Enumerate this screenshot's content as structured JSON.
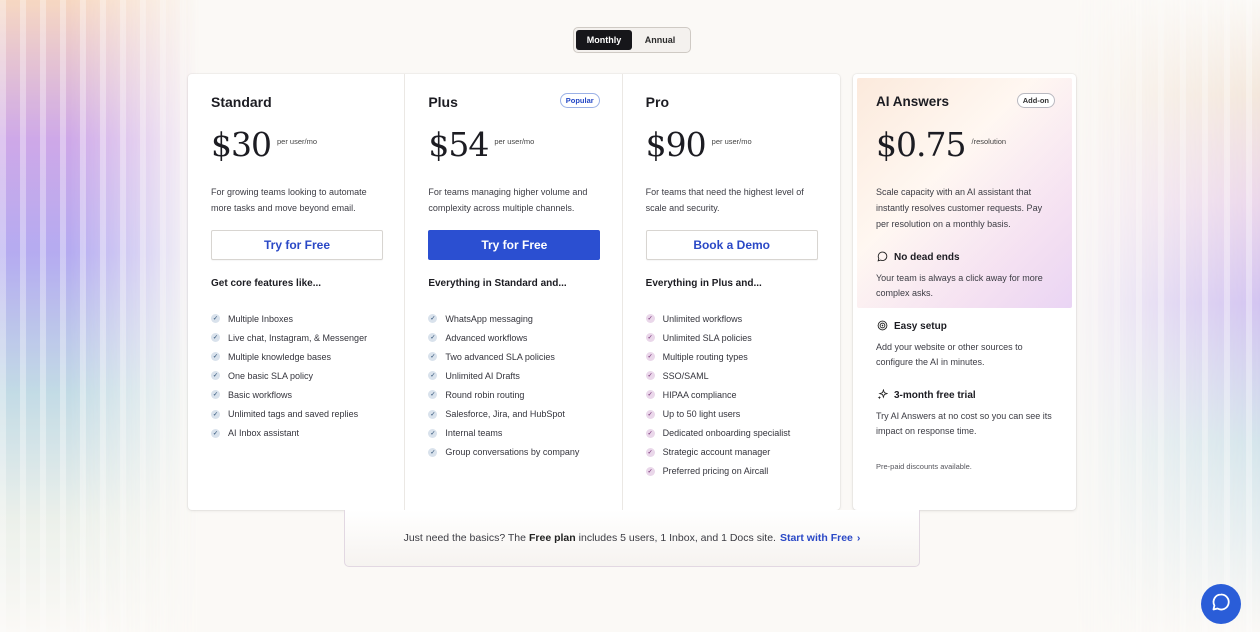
{
  "billing_toggle": {
    "monthly": "Monthly",
    "annual": "Annual",
    "selected": "Monthly"
  },
  "plans": [
    {
      "name": "Standard",
      "badge": "",
      "price": "$30",
      "unit": "per user/mo",
      "description": "For growing teams looking to automate more tasks and move beyond email.",
      "cta": "Try for Free",
      "features_heading": "Get core features like...",
      "features": [
        "Multiple Inboxes",
        "Live chat, Instagram, & Messenger",
        "Multiple knowledge bases",
        "One basic SLA policy",
        "Basic workflows",
        "Unlimited tags and saved replies",
        "AI Inbox assistant"
      ]
    },
    {
      "name": "Plus",
      "badge": "Popular",
      "price": "$54",
      "unit": "per user/mo",
      "description": "For teams managing higher volume and complexity across multiple channels.",
      "cta": "Try for Free",
      "features_heading": "Everything in Standard and...",
      "features": [
        "WhatsApp messaging",
        "Advanced workflows",
        "Two advanced SLA policies",
        "Unlimited AI Drafts",
        "Round robin routing",
        "Salesforce, Jira, and HubSpot",
        "Internal teams",
        "Group conversations by company"
      ]
    },
    {
      "name": "Pro",
      "badge": "",
      "price": "$90",
      "unit": "per user/mo",
      "description": "For teams that need the highest level of scale and security.",
      "cta": "Book a Demo",
      "features_heading": "Everything in Plus and...",
      "features": [
        "Unlimited workflows",
        "Unlimited SLA policies",
        "Multiple routing types",
        "SSO/SAML",
        "HIPAA compliance",
        "Up to 50 light users",
        "Dedicated onboarding specialist",
        "Strategic account manager",
        "Preferred pricing on Aircall"
      ]
    }
  ],
  "ai_answers": {
    "name": "AI Answers",
    "badge": "Add-on",
    "price": "$0.75",
    "unit": "/resolution",
    "description": "Scale capacity with an AI assistant that instantly resolves customer requests. Pay per resolution on a monthly basis.",
    "features": [
      {
        "icon": "chat-bubble-icon",
        "title": "No dead ends",
        "text": "Your team is always a click away for more complex asks."
      },
      {
        "icon": "target-icon",
        "title": "Easy setup",
        "text": "Add your website or other sources to configure the AI in minutes."
      },
      {
        "icon": "sparkle-icon",
        "title": "3-month free trial",
        "text": "Try AI Answers at no cost so you can see its impact on response time."
      }
    ],
    "footnote": "Pre-paid discounts available."
  },
  "free_bar": {
    "prefix": "Just need the basics? The",
    "bold": "Free plan",
    "suffix": "includes 5 users, 1 Inbox, and 1 Docs site.",
    "link": "Start with Free",
    "chevron": "›"
  },
  "colors": {
    "accent": "#2b4fd1",
    "dark": "#16161a",
    "chat": "#2a5dd8"
  }
}
